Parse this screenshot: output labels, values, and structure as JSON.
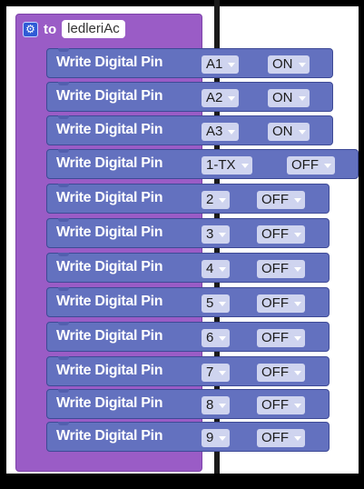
{
  "procedure": {
    "keyword": "to",
    "name": "ledleriAc",
    "gear_icon": "gear-icon"
  },
  "blocks": [
    {
      "label": "Write Digital Pin",
      "pin": "A1",
      "state": "ON"
    },
    {
      "label": "Write Digital Pin",
      "pin": "A2",
      "state": "ON"
    },
    {
      "label": "Write Digital Pin",
      "pin": "A3",
      "state": "ON"
    },
    {
      "label": "Write Digital Pin",
      "pin": "1-TX",
      "state": "OFF"
    },
    {
      "label": "Write Digital Pin",
      "pin": "2",
      "state": "OFF"
    },
    {
      "label": "Write Digital Pin",
      "pin": "3",
      "state": "OFF"
    },
    {
      "label": "Write Digital Pin",
      "pin": "4",
      "state": "OFF"
    },
    {
      "label": "Write Digital Pin",
      "pin": "5",
      "state": "OFF"
    },
    {
      "label": "Write Digital Pin",
      "pin": "6",
      "state": "OFF"
    },
    {
      "label": "Write Digital Pin",
      "pin": "7",
      "state": "OFF"
    },
    {
      "label": "Write Digital Pin",
      "pin": "8",
      "state": "OFF"
    },
    {
      "label": "Write Digital Pin",
      "pin": "9",
      "state": "OFF"
    }
  ],
  "colors": {
    "procedure_block": "#9a5cc6",
    "pin_block": "#6371bf",
    "dropdown": "#cfd4ef",
    "gear": "#2f5bd6"
  }
}
